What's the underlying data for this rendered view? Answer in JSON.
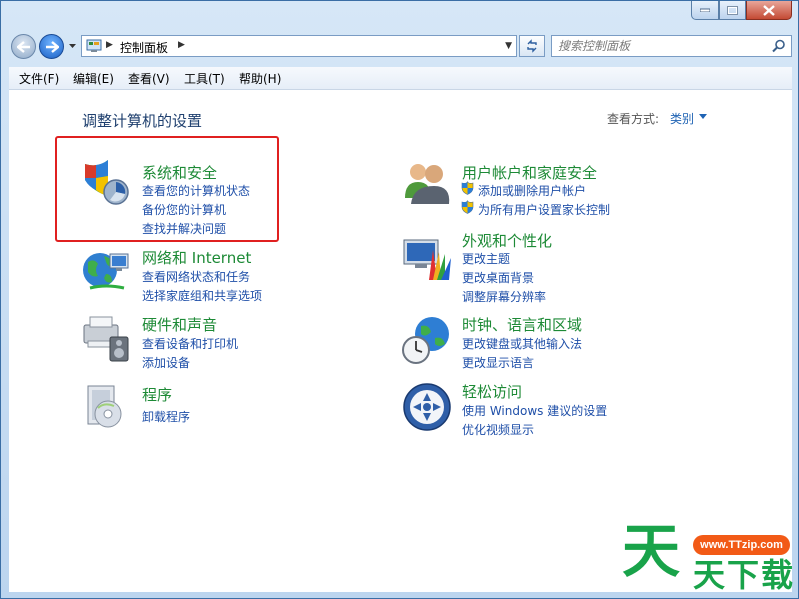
{
  "address": {
    "path": "控制面板"
  },
  "search": {
    "placeholder": "搜索控制面板"
  },
  "menu": [
    "文件(F)",
    "编辑(E)",
    "查看(V)",
    "工具(T)",
    "帮助(H)"
  ],
  "heading": "调整计算机的设置",
  "view_by": {
    "label": "查看方式:",
    "value": "类别"
  },
  "categories": [
    {
      "title": "系统和安全",
      "links": [
        "查看您的计算机状态",
        "备份您的计算机",
        "查找并解决问题"
      ]
    },
    {
      "title": "网络和 Internet",
      "links": [
        "查看网络状态和任务",
        "选择家庭组和共享选项"
      ]
    },
    {
      "title": "硬件和声音",
      "links": [
        "查看设备和打印机",
        "添加设备"
      ]
    },
    {
      "title": "程序",
      "links": [
        "卸载程序"
      ]
    },
    {
      "title": "用户帐户和家庭安全",
      "links": [
        "添加或删除用户帐户",
        "为所有用户设置家长控制"
      ]
    },
    {
      "title": "外观和个性化",
      "links": [
        "更改主题",
        "更改桌面背景",
        "调整屏幕分辨率"
      ]
    },
    {
      "title": "时钟、语言和区域",
      "links": [
        "更改键盘或其他输入法",
        "更改显示语言"
      ]
    },
    {
      "title": "轻松访问",
      "links": [
        "使用 Windows 建议的设置",
        "优化视频显示"
      ]
    }
  ],
  "watermark": {
    "url": "www.TTzip.com",
    "big": "天",
    "sub": "天下载"
  },
  "colors": {
    "title_green": "#1d8a36",
    "link_blue": "#1f4fa8",
    "highlight": "#e02020"
  }
}
